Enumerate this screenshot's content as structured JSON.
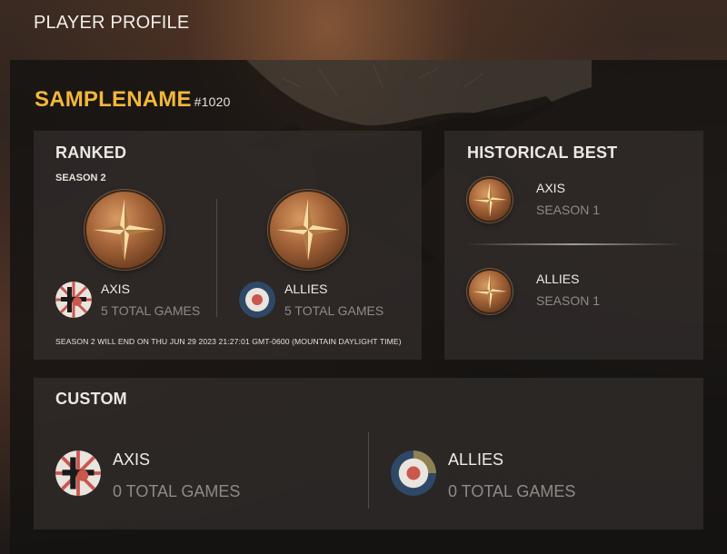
{
  "page": {
    "title": "PLAYER PROFILE"
  },
  "player": {
    "name": "SAMPLENAME",
    "tag": "#1020"
  },
  "ranked": {
    "title": "RANKED",
    "season": "SEASON 2",
    "axis": {
      "name": "AXIS",
      "games": "5 TOTAL GAMES"
    },
    "allies": {
      "name": "ALLIES",
      "games": "5 TOTAL GAMES"
    },
    "note": "SEASON 2 WILL END ON THU JUN 29 2023 21:27:01 GMT-0600 (MOUNTAIN DAYLIGHT TIME)"
  },
  "historical": {
    "title": "HISTORICAL BEST",
    "axis": {
      "name": "AXIS",
      "season": "SEASON 1"
    },
    "allies": {
      "name": "ALLIES",
      "season": "SEASON 1"
    }
  },
  "custom": {
    "title": "CUSTOM",
    "axis": {
      "name": "AXIS",
      "games": "0 TOTAL GAMES"
    },
    "allies": {
      "name": "ALLIES",
      "games": "0 TOTAL GAMES"
    }
  },
  "icons": {
    "rank_medal": "bronze-star-medal-icon",
    "axis": "axis-faction-icon",
    "allies": "allies-roundel-icon"
  },
  "colors": {
    "player_name": "#f3b73a",
    "muted_text": "#8f8a84",
    "panel_bg": "#141211"
  }
}
